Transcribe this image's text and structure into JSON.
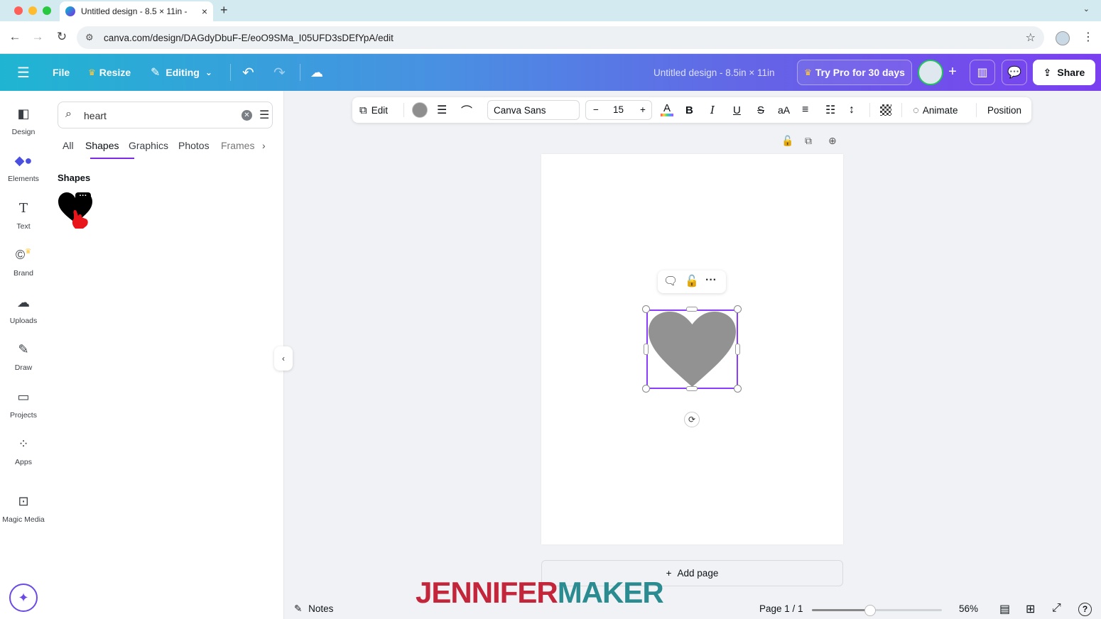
{
  "browser": {
    "tab_title": "Untitled design - 8.5 × 11in -",
    "tab_close": "×",
    "new_tab": "+",
    "tab_menu": "⌄",
    "url": "canva.com/design/DAGdyDbuF-E/eoO9SMa_I05UFD3sDEfYpA/edit",
    "traffic_colors": [
      "#ff5f57",
      "#febc2e",
      "#28c840"
    ]
  },
  "header": {
    "menu_icon": "☰",
    "file_label": "File",
    "resize_label": "Resize",
    "editing_label": "Editing",
    "design_title": "Untitled design - 8.5in × 11in",
    "try_pro_label": "Try Pro for 30 days",
    "share_label": "Share",
    "gradient_start": "#1fb5d2",
    "gradient_end": "#7a3ff0"
  },
  "rail": {
    "items": [
      {
        "label": "Design",
        "icon": "design-icon"
      },
      {
        "label": "Elements",
        "icon": "elements-icon"
      },
      {
        "label": "Text",
        "icon": "text-icon"
      },
      {
        "label": "Brand",
        "icon": "brand-icon"
      },
      {
        "label": "Uploads",
        "icon": "uploads-icon"
      },
      {
        "label": "Draw",
        "icon": "draw-icon"
      },
      {
        "label": "Projects",
        "icon": "projects-icon"
      },
      {
        "label": "Apps",
        "icon": "apps-icon"
      },
      {
        "label": "Magic Media",
        "icon": "magic-media-icon"
      }
    ],
    "active": "Elements"
  },
  "panel": {
    "search_value": "heart",
    "tabs": [
      "All",
      "Shapes",
      "Graphics",
      "Photos",
      "Frames"
    ],
    "active_tab": "Shapes",
    "section_title": "Shapes",
    "thumb_more": "···"
  },
  "toolbar": {
    "edit_label": "Edit",
    "fill_color": "#8e8e8e",
    "font_name": "Canva Sans",
    "font_size": "15",
    "decrease": "−",
    "increase": "+",
    "text_color_glyph": "A",
    "bold": "B",
    "italic": "I",
    "underline": "U",
    "strike": "S",
    "case": "aA",
    "animate_label": "Animate",
    "position_label": "Position"
  },
  "canvas": {
    "heart_color": "#929292",
    "selection_color": "#8b3dff",
    "add_page_label": "Add page"
  },
  "bottom": {
    "notes_label": "Notes",
    "page_indicator": "Page 1 / 1",
    "zoom_label": "56%",
    "help": "?",
    "zoom_fraction": 0.45
  },
  "watermark": {
    "part_a": "JENNIFER",
    "part_b": "MAKER",
    "color_a": "#c3253a",
    "color_b": "#2a8b90"
  }
}
